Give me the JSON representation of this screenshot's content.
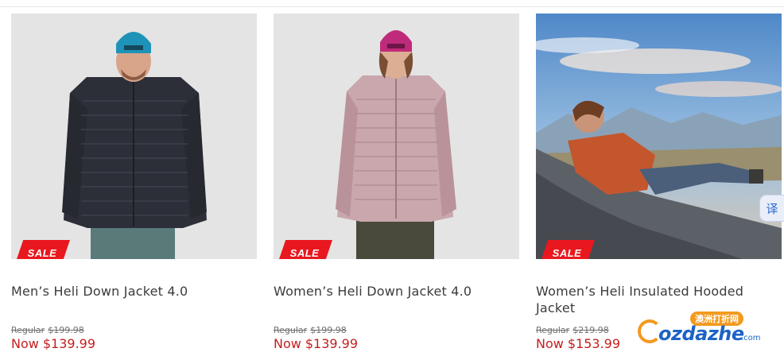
{
  "products": [
    {
      "badge": "SALE",
      "title": "Men’s Heli Down Jacket 4.0",
      "regular_label": "Regular",
      "regular_price": "$199.98",
      "now_label": "Now",
      "now_price": "$139.99",
      "colors": {
        "jacket": "#2c2f37",
        "beanie": "#1f93b7",
        "pants": "#5a7a7a"
      }
    },
    {
      "badge": "SALE",
      "title": "Women’s Heli Down Jacket 4.0",
      "regular_label": "Regular",
      "regular_price": "$199.98",
      "now_label": "Now",
      "now_price": "$139.99",
      "colors": {
        "jacket": "#c9a7ad",
        "beanie": "#c02a7a",
        "pants": "#4a4a3c"
      }
    },
    {
      "badge": "SALE",
      "title": "Women’s Heli Insulated Hooded Jacket",
      "regular_label": "Regular",
      "regular_price": "$219.98",
      "now_label": "Now",
      "now_price": "$153.99",
      "colors": {
        "jacket": "#c4562e",
        "sky": "#6fa2d4",
        "rock": "#5c6167"
      }
    }
  ],
  "translate_tab": {
    "label": "译"
  },
  "watermark": {
    "cn": "澳洲打折网",
    "brand": "ozdazhe",
    "suffix": ".com"
  },
  "colors": {
    "sale_badge": "#e8181e",
    "now_price": "#c41f1f"
  }
}
